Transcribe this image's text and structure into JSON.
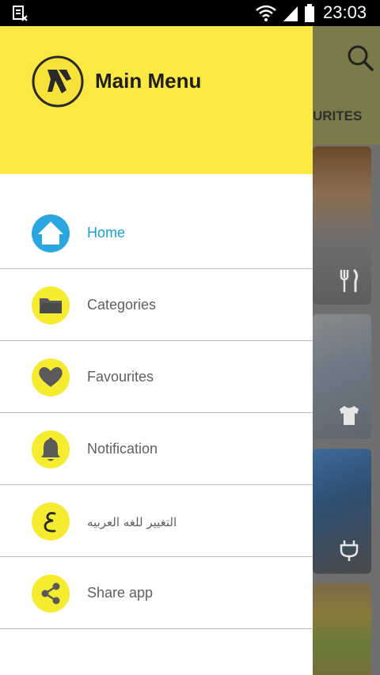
{
  "status_bar": {
    "time": "23:03",
    "icons": [
      "sim-missing-icon",
      "wifi-icon",
      "signal-icon",
      "battery-icon"
    ]
  },
  "background_app": {
    "tab_label_visible": "URITES",
    "icons": [
      "search-icon",
      "fork-knife-icon",
      "shirt-icon",
      "plug-icon"
    ]
  },
  "drawer": {
    "header": {
      "title": "Main Menu",
      "logo_icon": "walking-fingers-logo",
      "background": "#fbe843"
    },
    "items": [
      {
        "label": "Home",
        "icon": "home-icon",
        "active": true
      },
      {
        "label": "Categories",
        "icon": "folder-icon",
        "active": false
      },
      {
        "label": "Favourites",
        "icon": "heart-icon",
        "active": false
      },
      {
        "label": "Notification",
        "icon": "bell-icon",
        "active": false
      },
      {
        "label": "التغيير للغه العربيه",
        "icon": "arabic-letter-icon",
        "active": false
      },
      {
        "label": "Share app",
        "icon": "share-icon",
        "active": false
      }
    ]
  },
  "colors": {
    "accent_yellow": "#f6ec2f",
    "active_blue": "#1aa0d8",
    "icon_gray": "#5a5a5a"
  }
}
